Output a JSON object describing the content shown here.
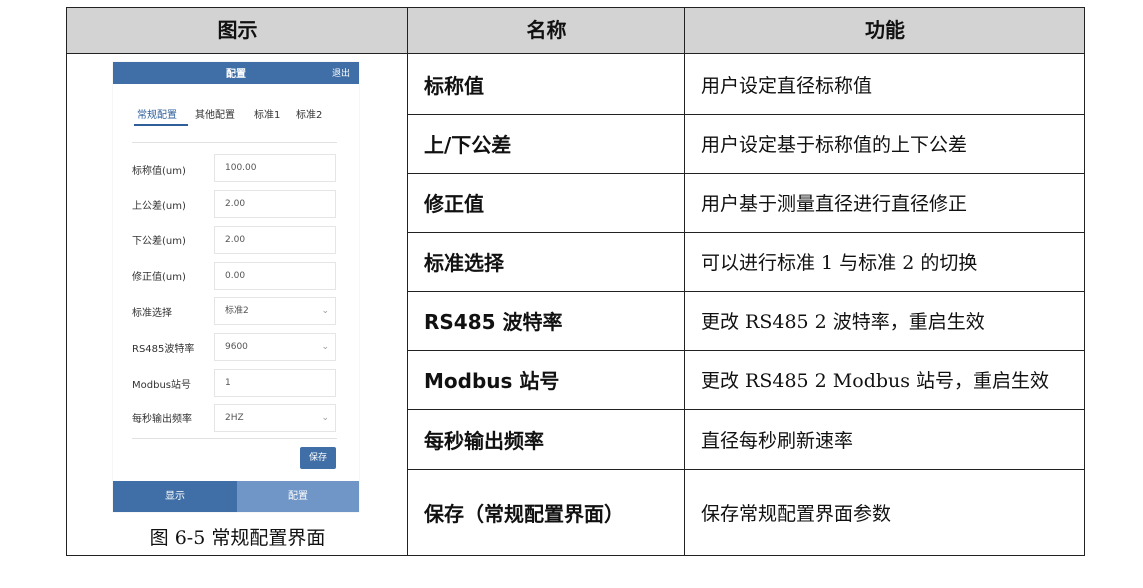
{
  "headers": [
    "图示",
    "名称",
    "功能"
  ],
  "rows": [
    {
      "name": "标称值",
      "function": "用户设定直径标称值"
    },
    {
      "name": "上/下公差",
      "function": "用户设定基于标称值的上下公差"
    },
    {
      "name": "修正值",
      "function": "用户基于测量直径进行直径修正"
    },
    {
      "name": "标准选择",
      "function": "可以进行标准 1 与标准 2 的切换"
    },
    {
      "name": "RS485 波特率",
      "function": "更改 RS485 2 波特率，重启生效"
    },
    {
      "name": "Modbus 站号",
      "function": "更改 RS485 2 Modbus 站号，重启生效"
    },
    {
      "name": "每秒输出频率",
      "function": "直径每秒刷新速率"
    },
    {
      "name": "保存（常规配置界面）",
      "function": "保存常规配置界面参数"
    }
  ],
  "caption": "图 6-5 常规配置界面",
  "phone": {
    "title": "配置",
    "exit": "退出",
    "tabs": [
      "常规配置",
      "其他配置",
      "标准1",
      "标准2"
    ],
    "fields": [
      {
        "label": "标称值(um)",
        "value": "100.00"
      },
      {
        "label": "上公差(um)",
        "value": "2.00"
      },
      {
        "label": "下公差(um)",
        "value": "2.00"
      },
      {
        "label": "修正值(um)",
        "value": "0.00"
      },
      {
        "label": "标准选择",
        "value": "标准2"
      },
      {
        "label": "RS485波特率",
        "value": "9600"
      },
      {
        "label": "Modbus站号",
        "value": "1"
      },
      {
        "label": "每秒输出频率",
        "value": "2HZ"
      }
    ],
    "save": "保存",
    "nav": [
      "显示",
      "配置"
    ],
    "colors": {
      "primary": "#3f6fa6",
      "secondary": "#6f96c6"
    }
  }
}
